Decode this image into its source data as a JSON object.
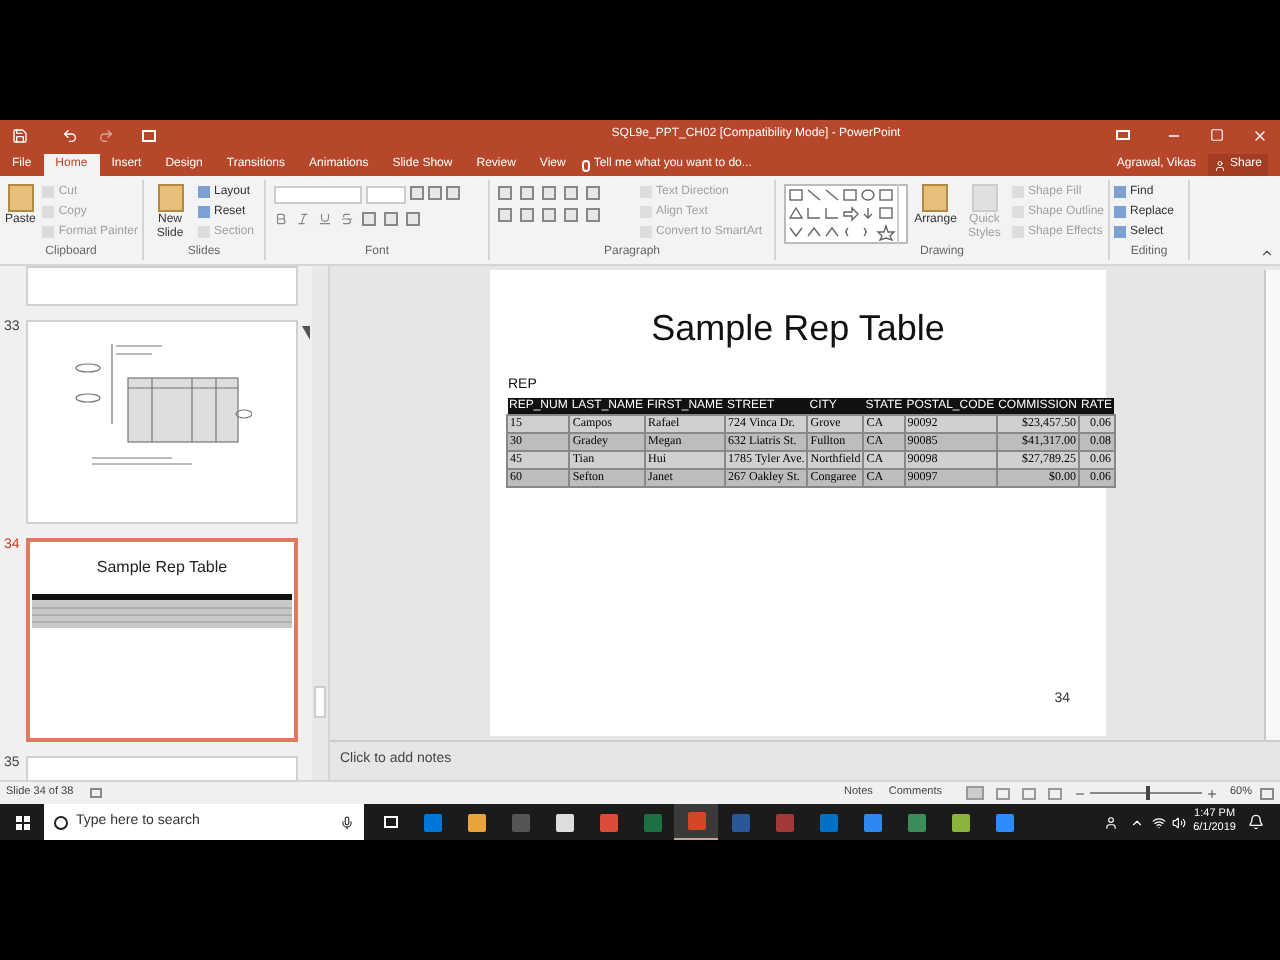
{
  "window": {
    "title": "SQL9e_PPT_CH02 [Compatibility Mode] - PowerPoint"
  },
  "tabs": [
    {
      "label": "File",
      "selected": false
    },
    {
      "label": "Home",
      "selected": true
    },
    {
      "label": "Insert",
      "selected": false
    },
    {
      "label": "Design",
      "selected": false
    },
    {
      "label": "Transitions",
      "selected": false
    },
    {
      "label": "Animations",
      "selected": false
    },
    {
      "label": "Slide Show",
      "selected": false
    },
    {
      "label": "Review",
      "selected": false
    },
    {
      "label": "View",
      "selected": false
    }
  ],
  "tell_me": "Tell me what you want to do...",
  "user": "Agrawal, Vikas",
  "share": "Share",
  "ribbon": [
    {
      "kind": "clipboard",
      "label": "Clipboard",
      "large": [
        {
          "label": "Paste",
          "disabled": false
        }
      ],
      "small": [
        {
          "label": "Cut",
          "disabled": true
        },
        {
          "label": "Copy",
          "disabled": true
        },
        {
          "label": "Format Painter",
          "disabled": true
        }
      ]
    },
    {
      "kind": "slides",
      "label": "Slides",
      "large": [
        {
          "label": "New Slide",
          "disabled": false
        }
      ],
      "small": [
        {
          "label": "Layout",
          "disabled": false
        },
        {
          "label": "Reset",
          "disabled": false
        },
        {
          "label": "Section",
          "disabled": true
        }
      ]
    },
    {
      "kind": "font",
      "label": "Font"
    },
    {
      "kind": "paragraph",
      "label": "Paragraph",
      "small": [
        {
          "label": "Text Direction",
          "disabled": true
        },
        {
          "label": "Align Text",
          "disabled": true
        },
        {
          "label": "Convert to SmartArt",
          "disabled": true
        }
      ]
    },
    {
      "kind": "drawing",
      "label": "Drawing",
      "large": [
        {
          "label": "Arrange",
          "disabled": false
        },
        {
          "label": "Quick Styles",
          "disabled": true
        }
      ],
      "small": [
        {
          "label": "Shape Fill",
          "disabled": true
        },
        {
          "label": "Shape Outline",
          "disabled": true
        },
        {
          "label": "Shape Effects",
          "disabled": true
        }
      ]
    },
    {
      "kind": "editing",
      "label": "Editing",
      "small": [
        {
          "label": "Find",
          "disabled": false
        },
        {
          "label": "Replace",
          "disabled": false
        },
        {
          "label": "Select",
          "disabled": false
        }
      ]
    }
  ],
  "thumbnails": [
    {
      "number": "33",
      "kind": "diagram",
      "selected": false
    },
    {
      "number": "34",
      "kind": "table",
      "title": "Sample Rep Table",
      "selected": true
    },
    {
      "number": "35",
      "kind": "blank",
      "selected": false
    }
  ],
  "slide": {
    "title": "Sample Rep Table",
    "table_name": "REP",
    "number": "34",
    "columns": [
      "REP_NUM",
      "LAST_NAME",
      "FIRST_NAME",
      "STREET",
      "CITY",
      "STATE",
      "POSTAL_CODE",
      "COMMISSION",
      "RATE"
    ],
    "rows": [
      [
        "15",
        "Campos",
        "Rafael",
        "724 Vinca Dr.",
        "Grove",
        "CA",
        "90092",
        "$23,457.50",
        "0.06"
      ],
      [
        "30",
        "Gradey",
        "Megan",
        "632 Liatris St.",
        "Fullton",
        "CA",
        "90085",
        "$41,317.00",
        "0.08"
      ],
      [
        "45",
        "Tian",
        "Hui",
        "1785 Tyler Ave.",
        "Northfield",
        "CA",
        "90098",
        "$27,789.25",
        "0.06"
      ],
      [
        "60",
        "Sefton",
        "Janet",
        "267 Oakley St.",
        "Congaree",
        "CA",
        "90097",
        "$0.00",
        "0.06"
      ]
    ]
  },
  "notes_placeholder": "Click to add notes",
  "status_bar": {
    "slide": "Slide 34 of 38",
    "notes": "Notes",
    "comments": "Comments",
    "zoom": "60%",
    "level": 0.5
  },
  "taskbar": {
    "search_placeholder": "Type here to search",
    "time": "1:47 PM",
    "date": "6/1/2019",
    "apps": [
      {
        "color": "#0078d7",
        "selected": false
      },
      {
        "color": "#e8a33d",
        "selected": false
      },
      {
        "color": "#555555",
        "selected": false
      },
      {
        "color": "#dddddd",
        "selected": false
      },
      {
        "color": "#dd4b39",
        "selected": false
      },
      {
        "color": "#1e7145",
        "selected": false
      },
      {
        "color": "#d24726",
        "selected": true
      },
      {
        "color": "#2b579a",
        "selected": false
      },
      {
        "color": "#a4373a",
        "selected": false
      },
      {
        "color": "#0072c6",
        "selected": false
      },
      {
        "color": "#2d89ef",
        "selected": false
      },
      {
        "color": "#3c8c5c",
        "selected": false
      },
      {
        "color": "#8cb33c",
        "selected": false
      },
      {
        "color": "#2d8cff",
        "selected": false
      }
    ]
  }
}
